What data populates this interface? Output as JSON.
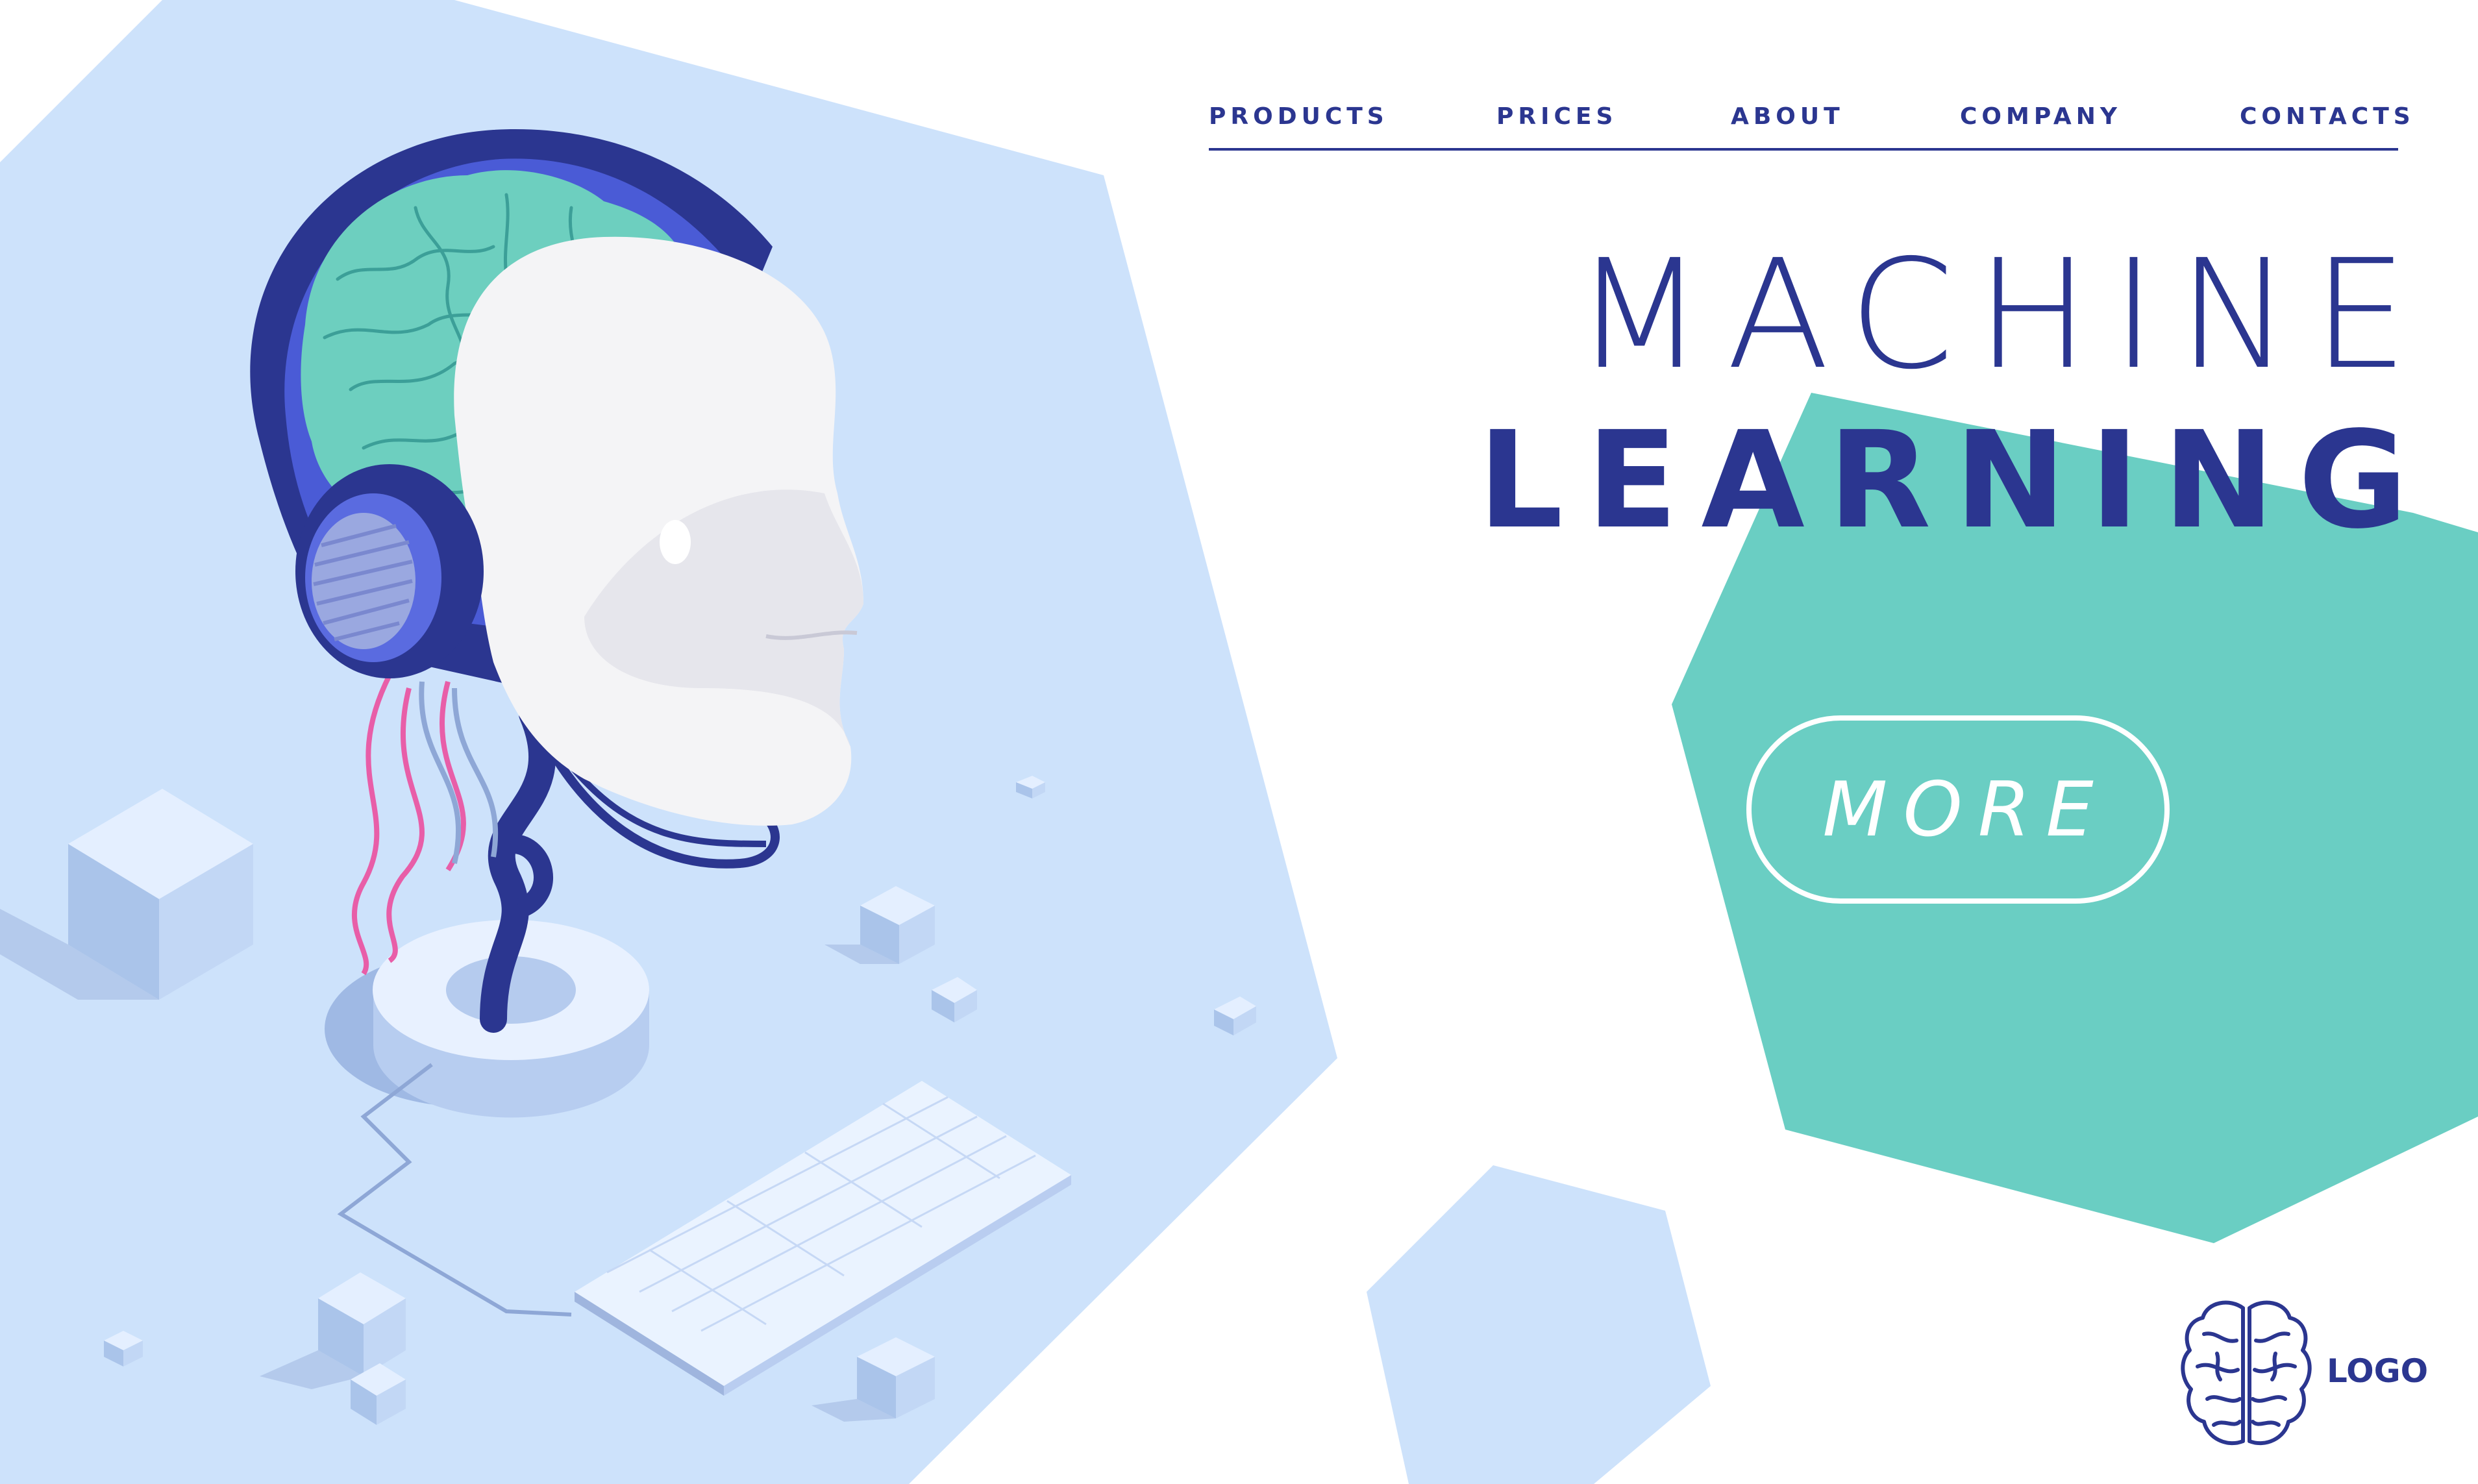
{
  "nav": {
    "items": [
      {
        "label": "PRODUCTS"
      },
      {
        "label": "PRICES"
      },
      {
        "label": "ABOUT"
      },
      {
        "label": "COMPANY"
      },
      {
        "label": "CONTACTS"
      }
    ]
  },
  "hero": {
    "title_line1": "MACHINE",
    "title_line2": "LEARNING",
    "cta_label": "MORE"
  },
  "footer": {
    "logo_label": "LOGO"
  },
  "illustration": {
    "subject": "robot-head-with-brain-and-headphones",
    "props": [
      "keyboard",
      "pedestal",
      "cubes",
      "cables"
    ]
  },
  "colors": {
    "primary_navy": "#2b3690",
    "light_blue_panel": "#cde2fb",
    "teal": "#6acec3",
    "white": "#ffffff",
    "brain_teal": "#6dcfbf",
    "headphone_blue": "#4a5bd6",
    "cable_pink": "#e85ea8"
  }
}
